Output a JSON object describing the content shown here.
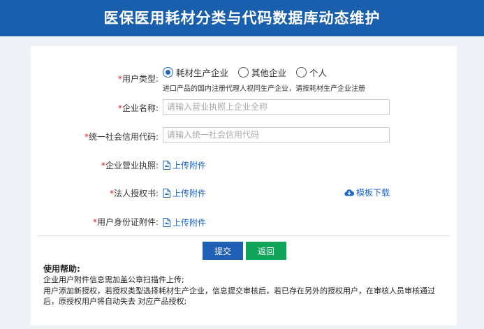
{
  "header": {
    "title": "医保医用耗材分类与代码数据库动态维护"
  },
  "form": {
    "user_type": {
      "label": "用户类型:",
      "options": [
        "耗材生产企业",
        "其他企业",
        "个人"
      ],
      "selected": "耗材生产企业",
      "hint": "进口产品的国内注册代理人视同生产企业，请按耗材生产企业注册"
    },
    "company_name": {
      "label": "企业名称:",
      "value": "",
      "placeholder": "请输入营业执照上企业全称"
    },
    "credit_code": {
      "label": "统一社会信用代码:",
      "value": "",
      "placeholder": "请输入统一社会信用代码"
    },
    "business_license": {
      "label": "企业营业执照:",
      "upload_label": "上传附件"
    },
    "authorization": {
      "label": "法人授权书:",
      "upload_label": "上传附件",
      "template_label": "模板下载"
    },
    "id_card": {
      "label": "用户身份证附件:",
      "upload_label": "上传附件"
    },
    "required_mark": "*"
  },
  "buttons": {
    "submit": "提交",
    "back": "返回"
  },
  "help": {
    "title": "使用帮助:",
    "lines": [
      "企业用户附件信息需加盖公章扫描件上传;",
      "用户添加新授权，若授权类型选择耗材生产企业，信息提交审核后，若已存在另外的授权用户，在审核人员审核通过后，原授权用户将自动失去 对应产品授权;"
    ]
  },
  "colors": {
    "header_bg": "#1a5fae",
    "link": "#1a66c9",
    "submit": "#1f5fb6",
    "back": "#10a35a",
    "required": "#e02020"
  }
}
